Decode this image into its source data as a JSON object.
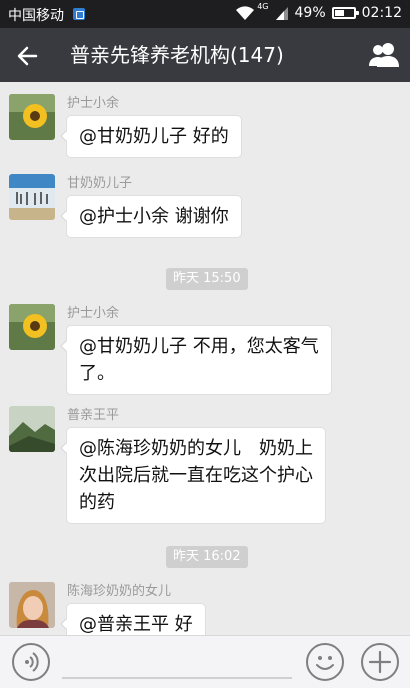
{
  "status_bar": {
    "carrier": "中国移动",
    "network": "4G",
    "battery": "49%",
    "battery_level": 0.49,
    "time": "02:12"
  },
  "header": {
    "title": "普亲先锋养老机构(147)",
    "back_icon": "back-arrow-icon",
    "members_icon": "group-members-icon"
  },
  "messages": [
    {
      "sender": "护士小余",
      "text": "@甘奶奶儿子 好的",
      "avatar": "sunflower-avatar"
    },
    {
      "sender": "甘奶奶儿子",
      "text": "@护士小余 谢谢你",
      "avatar": "calligraphy-avatar"
    },
    {
      "sender": "护士小余",
      "text_lines": [
        "@甘奶奶儿子 不用，您太客气",
        "了。"
      ],
      "avatar": "sunflower-avatar"
    },
    {
      "sender": "普亲王平",
      "text_lines": [
        "@陈海珍奶奶的女儿　奶奶上",
        "次出院后就一直在吃这个护心",
        "的药"
      ],
      "avatar": "landscape-avatar"
    },
    {
      "sender": "陈海珍奶奶的女儿",
      "text": "@普亲王平 好",
      "avatar": "woman-portrait-avatar"
    }
  ],
  "timestamps": [
    "昨天 15:50",
    "昨天 16:02"
  ],
  "input_bar": {
    "voice_icon": "voice-icon",
    "emoji_icon": "emoji-icon",
    "plus_icon": "plus-icon",
    "placeholder": ""
  }
}
